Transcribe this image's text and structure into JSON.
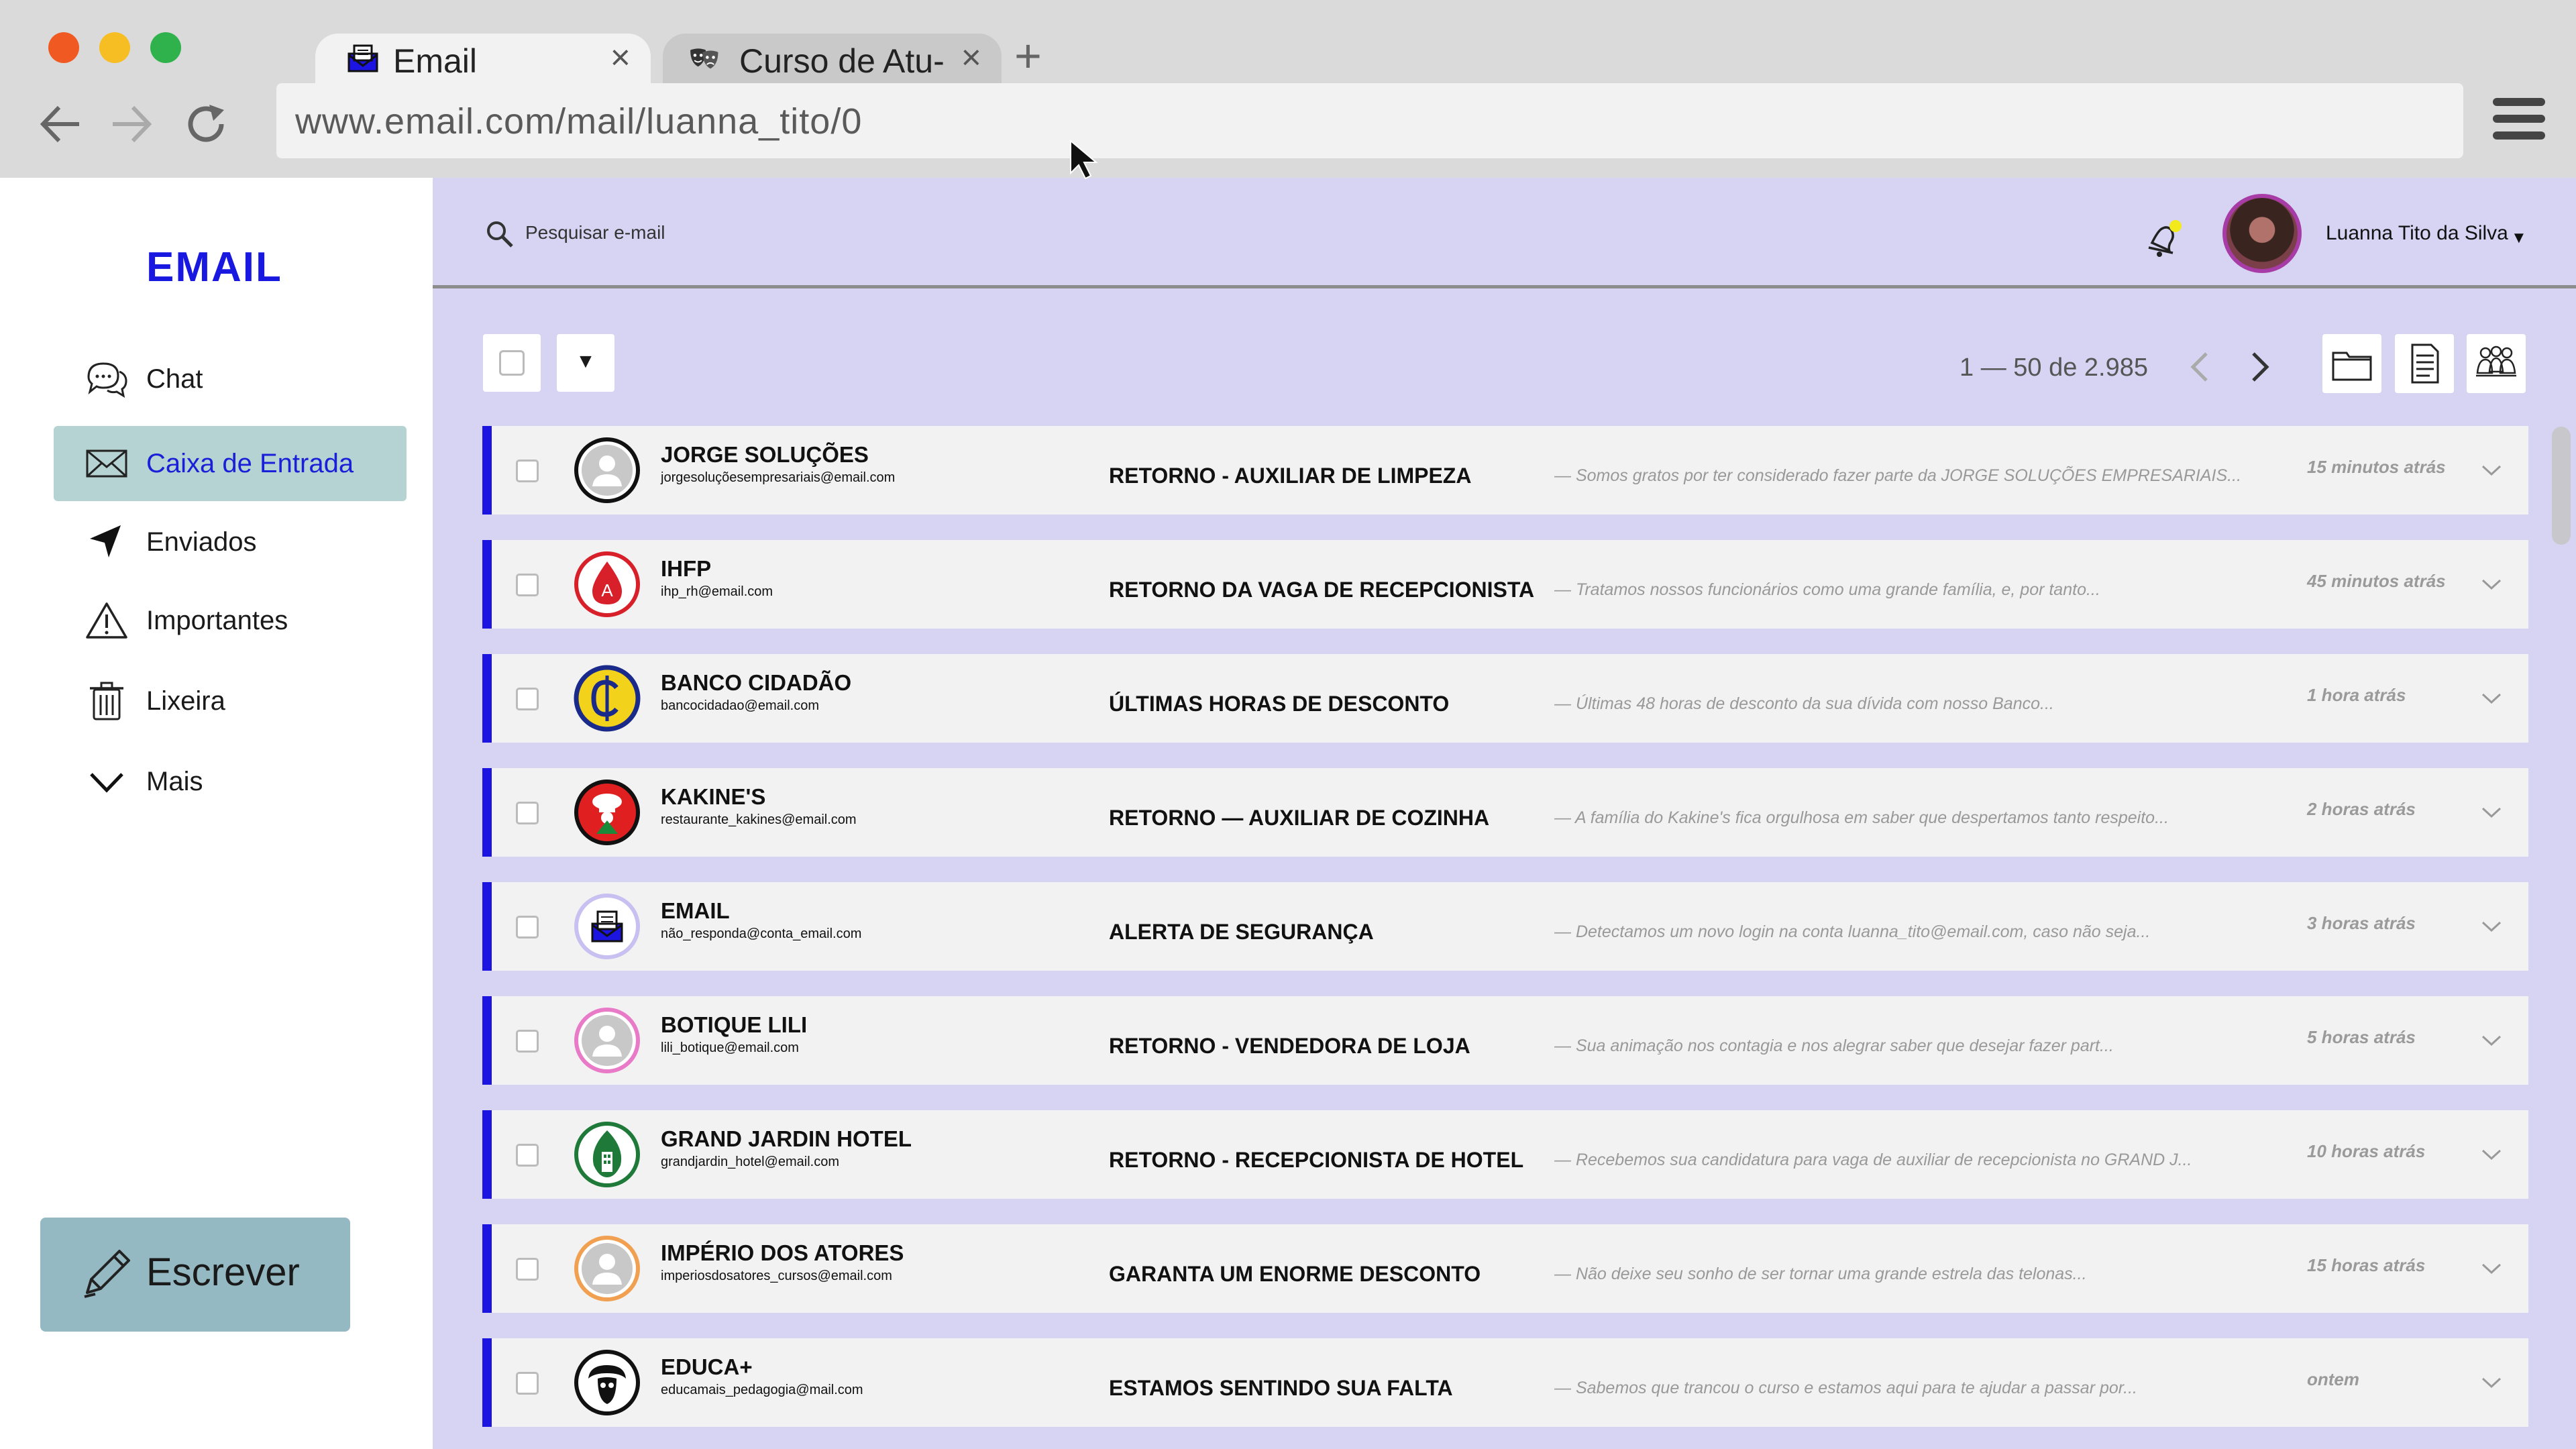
{
  "browser": {
    "tabs": [
      {
        "label": "Email",
        "icon": "envelope-tab-icon",
        "active": true
      },
      {
        "label": "Curso de Atu-",
        "icon": "theater-masks-icon",
        "active": false
      }
    ],
    "close_glyph": "×",
    "new_tab_glyph": "+",
    "url": "www.email.com/mail/luanna_tito/0"
  },
  "sidebar": {
    "brand": "EMAIL",
    "items": [
      {
        "label": "Chat",
        "icon": "chat-bubbles-icon"
      },
      {
        "label": "Caixa de Entrada",
        "icon": "envelope-icon",
        "active": true
      },
      {
        "label": "Enviados",
        "icon": "send-arrow-icon"
      },
      {
        "label": "Importantes",
        "icon": "warning-icon"
      },
      {
        "label": "Lixeira",
        "icon": "trash-icon"
      },
      {
        "label": "Mais",
        "icon": "chevron-down-icon"
      }
    ],
    "compose": {
      "label": "Escrever",
      "icon": "pencil-icon"
    }
  },
  "topbar": {
    "search_placeholder": "Pesquisar e-mail",
    "user_name": "Luanna Tito da Silva",
    "user_caret": "▼"
  },
  "toolbar": {
    "dropdown_glyph": "▼",
    "pager": "1 — 50 de 2.985"
  },
  "colors": {
    "accent": "#1c14e0",
    "main_bg": "#d6d4f2",
    "active_nav": "#b6d3d3",
    "compose_bg": "#94b9c3"
  },
  "emails": [
    {
      "sender": "JORGE SOLUÇÕES",
      "address": "jorgesoluçõesempresariais@email.com",
      "subject": "RETORNO - AUXILIAR DE LIMPEZA",
      "preview": "— Somos gratos por ter considerado fazer parte da JORGE SOLUÇÕES EMPRESARIAIS...",
      "time": "15 minutos atrás",
      "avatar": "default-user-avatar-icon"
    },
    {
      "sender": "IHFP",
      "address": "ihp_rh@email.com",
      "subject": "RETORNO DA VAGA DE RECEPCIONISTA",
      "preview": "— Tratamos nossos funcionários como uma grande família, e, por tanto...",
      "time": "45 minutos atrás",
      "avatar": "blood-drop-logo-icon"
    },
    {
      "sender": "BANCO CIDADÃO",
      "address": "bancocidadao@email.com",
      "subject": "ÚLTIMAS HORAS DE DESCONTO",
      "preview": "— Últimas 48 horas de desconto da sua dívida com nosso Banco...",
      "time": "1 hora atrás",
      "avatar": "bank-coin-logo-icon"
    },
    {
      "sender": "KAKINE'S",
      "address": "restaurante_kakines@email.com",
      "subject": "RETORNO — AUXILIAR DE COZINHA",
      "preview": "— A família do Kakine's fica orgulhosa em saber que despertamos tanto respeito...",
      "time": "2 horas atrás",
      "avatar": "chef-hat-logo-icon"
    },
    {
      "sender": "EMAIL",
      "address": "não_responda@conta_email.com",
      "subject": "ALERTA DE SEGURANÇA",
      "preview": "— Detectamos um novo login na conta luanna_tito@email.com, caso não seja...",
      "time": "3 horas atrás",
      "avatar": "envelope-logo-icon"
    },
    {
      "sender": "BOTIQUE LILI",
      "address": "lili_botique@email.com",
      "subject": "RETORNO - VENDEDORA DE LOJA",
      "preview": "— Sua animação nos contagia e nos alegrar saber que desejar fazer part...",
      "time": "5 horas atrás",
      "avatar": "default-user-avatar-icon"
    },
    {
      "sender": "GRAND JARDIN HOTEL",
      "address": "grandjardin_hotel@email.com",
      "subject": "RETORNO - RECEPCIONISTA DE HOTEL",
      "preview": "— Recebemos sua candidatura para vaga de auxiliar de recepcionista no GRAND J...",
      "time": "10 horas atrás",
      "avatar": "hotel-leaf-logo-icon"
    },
    {
      "sender": "IMPÉRIO DOS ATORES",
      "address": "imperiosdosatores_cursos@email.com",
      "subject": "GARANTA UM ENORME DESCONTO",
      "preview": "— Não deixe seu sonho de ser tornar uma grande estrela das telonas...",
      "time": "15 horas atrás",
      "avatar": "default-user-avatar-icon"
    },
    {
      "sender": "EDUCA+",
      "address": "educamais_pedagogia@mail.com",
      "subject": "ESTAMOS SENTINDO SUA FALTA",
      "preview": "— Sabemos que trancou o curso e estamos aqui para te ajudar a passar por...",
      "time": "ontem",
      "avatar": "owl-logo-icon"
    }
  ]
}
